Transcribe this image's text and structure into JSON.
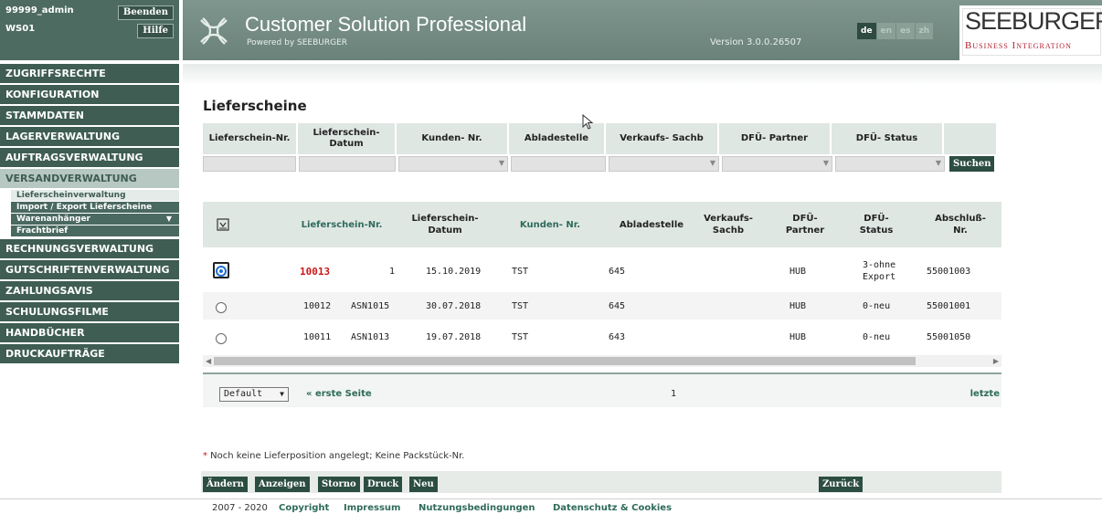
{
  "user": {
    "name": "99999_admin",
    "workstation": "WS01",
    "logout_label": "Beenden",
    "help_label": "Hilfe"
  },
  "header": {
    "title": "Customer Solution Professional",
    "subtitle": "Powered by SEEBURGER",
    "version": "Version 3.0.0.26507",
    "languages": [
      "de",
      "en",
      "es",
      "zh"
    ],
    "active_language": "de",
    "brand_main": "SEEBURGER",
    "brand_sub": "Business Integration"
  },
  "sidebar": {
    "items_top": [
      "ZUGRIFFSRECHTE",
      "KONFIGURATION",
      "STAMMDATEN",
      "LAGERVERWALTUNG",
      "AUFTRAGSVERWALTUNG"
    ],
    "active_item": "VERSANDVERWALTUNG",
    "sub_items": [
      "Lieferscheinverwaltung",
      "Import / Export Lieferscheine",
      "Warenanhänger",
      "Frachtbrief"
    ],
    "items_bottom": [
      "RECHNUNGSVERWALTUNG",
      "GUTSCHRIFTENVERWALTUNG",
      "ZAHLUNGSAVIS",
      "SCHULUNGSFILME",
      "HANDBÜCHER",
      "DRUCKAUFTRÄGE"
    ]
  },
  "page": {
    "title": "Lieferscheine"
  },
  "search": {
    "headers": [
      "Lieferschein-Nr.",
      "Lieferschein-\nDatum",
      "Kunden- Nr.",
      "Abladestelle",
      "Verkaufs- Sachb",
      "DFÜ- Partner",
      "DFÜ- Status"
    ],
    "button": "Suchen"
  },
  "table": {
    "headers": [
      "Lieferschein-Nr.",
      "Lieferschein-\nDatum",
      "Kunden- Nr.",
      "Abladestelle",
      "Verkaufs-\nSachb",
      "DFÜ-\nPartner",
      "DFÜ-\nStatus",
      "Abschluß-\nNr."
    ],
    "rows": [
      {
        "nr": "10013",
        "pos": "1",
        "datum": "15.10.2019",
        "kunde": "TST",
        "ablade": "645",
        "partner": "HUB",
        "status": "3-ohne\nExport",
        "abschluss": "55001003",
        "selected": true
      },
      {
        "nr": "10012",
        "pos": "ASN1015",
        "datum": "30.07.2018",
        "kunde": "TST",
        "ablade": "645",
        "partner": "HUB",
        "status": "0-neu",
        "abschluss": "55001001",
        "selected": false
      },
      {
        "nr": "10011",
        "pos": "ASN1013",
        "datum": "19.07.2018",
        "kunde": "TST",
        "ablade": "643",
        "partner": "HUB",
        "status": "0-neu",
        "abschluss": "55001050",
        "selected": false
      }
    ]
  },
  "pager": {
    "select": "Default",
    "first": "« erste Seite",
    "page": "1",
    "last": "letzte"
  },
  "note": {
    "star": "*",
    "text": " Noch keine Lieferposition angelegt; Keine Packstück-Nr."
  },
  "actions": {
    "edit": "Ändern",
    "view": "Anzeigen",
    "cancel": "Storno",
    "print": "Druck",
    "new": "Neu",
    "back": "Zurück"
  },
  "footer": {
    "years": "2007 - 2020",
    "copyright": "Copyright",
    "imprint": "Impressum",
    "terms": "Nutzungsbedingungen",
    "privacy": "Datenschutz & Cookies"
  },
  "colors": {
    "sidebar": "#3f5d52",
    "header": "#6a8279",
    "accent_red": "#cc1616",
    "link": "#2f6b5a"
  }
}
